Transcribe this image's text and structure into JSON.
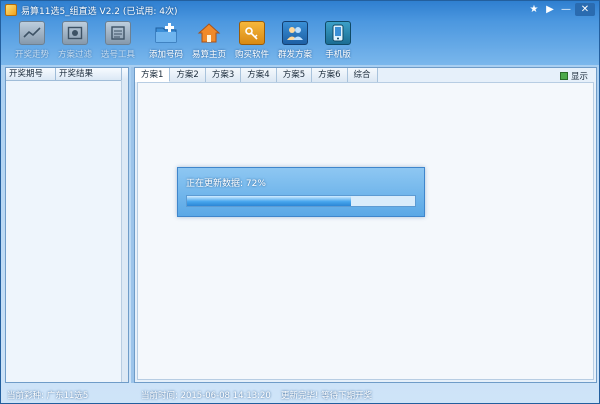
{
  "window": {
    "title": "易算11选5_组直选 V2.2 (已试用: 4次)",
    "controls": [
      "★",
      "▶",
      "—",
      "✕"
    ]
  },
  "toolbar": {
    "items": [
      {
        "label": "开奖走势",
        "icon": "trend-chart-icon",
        "enabled": false
      },
      {
        "label": "方案过滤",
        "icon": "filter-icon",
        "enabled": false
      },
      {
        "label": "选号工具",
        "icon": "tools-icon",
        "enabled": false
      },
      {
        "label": "添加号码",
        "icon": "add-folder-icon",
        "enabled": true
      },
      {
        "label": "易算主页",
        "icon": "home-icon",
        "enabled": true
      },
      {
        "label": "购买软件",
        "icon": "key-icon",
        "enabled": true
      },
      {
        "label": "群发方案",
        "icon": "users-icon",
        "enabled": true
      },
      {
        "label": "手机版",
        "icon": "mobile-icon",
        "enabled": true
      }
    ]
  },
  "left_panel": {
    "columns": [
      "开奖期号",
      "开奖结果"
    ]
  },
  "right_panel": {
    "tabs": [
      "方案1",
      "方案2",
      "方案3",
      "方案4",
      "方案5",
      "方案6",
      "综合"
    ],
    "active_tab": 0,
    "show_label": "显示"
  },
  "progress_dialog": {
    "message": "正在更新数据: 72%",
    "progress_percent": 72
  },
  "status_bar": {
    "lottery": "当前彩种: 广东11选5",
    "time": "当前时间: 2015-06-08 14:13:20",
    "update": "更新完毕! 等待下期开奖"
  },
  "colors": {
    "title_bar": "#2f7fd0",
    "toolbar_bg": "#7ab7ec",
    "progress_fill": "#47a6ee"
  }
}
